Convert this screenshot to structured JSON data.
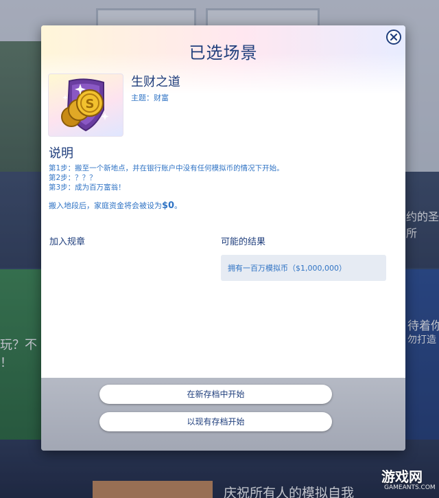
{
  "background": {
    "right_band_text": "约的圣所",
    "left_card_text": "玩？不",
    "left_card_text2": "！",
    "right_card_text": "待着你",
    "right_card_text2": "勿打造",
    "bottom_banner_text": "庆祝所有人的模拟自我"
  },
  "modal": {
    "title": "已选场景",
    "close_icon": "close-icon",
    "scenario": {
      "name": "生财之道",
      "theme": "主题：财富",
      "icon": "gold-coins-shield-icon"
    },
    "description": {
      "heading": "说明",
      "steps": [
        "第1步：搬至一个新地点，并在银行账户中没有任何模拟币的情况下开始。",
        "第2步：？？？",
        "第3步：成为百万富翁！"
      ],
      "funds_note": "搬入地段后，家庭资金将会被设为",
      "funds_value": "$0",
      "funds_suffix": "。"
    },
    "rules_heading": "加入规章",
    "outcomes_heading": "可能的结果",
    "outcomes": [
      "拥有一百万模拟币（$1,000,000）"
    ],
    "buttons": {
      "new_save": "在新存档中开始",
      "existing_save": "以现有存档开始"
    }
  },
  "watermark": {
    "main": "游戏网",
    "sub": "GAMEANTS.COM"
  },
  "colors": {
    "title_blue": "#1f3e7c",
    "text_blue": "#2f73c4",
    "outcome_bg": "#e6ebf3"
  }
}
